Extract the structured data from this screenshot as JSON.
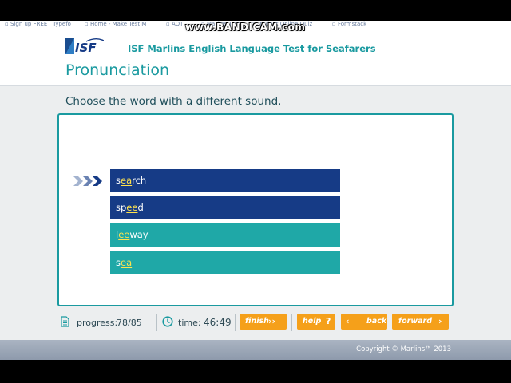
{
  "bookmarks": [
    "Sign up FREE | Typefo",
    "Home - Make Test M",
    "AQT",
    "Marlins Test",
    "Student Online Quiz",
    "Formstack"
  ],
  "watermark": "www.BANDICAM.com",
  "header": {
    "logo_text": "ISF",
    "app_title": "ISF Marlins English Language Test for Seafarers",
    "page_title": "Pronunciation"
  },
  "question": {
    "prompt": "Choose the word with a different sound.",
    "options": [
      {
        "pre": "s",
        "hl": "ea",
        "post": "rch",
        "style": "navy"
      },
      {
        "pre": "sp",
        "hl": "ee",
        "post": "d",
        "style": "navy"
      },
      {
        "pre": "l",
        "hl": "ee",
        "post": "way",
        "style": "teal"
      },
      {
        "pre": "s",
        "hl": "ea",
        "post": "",
        "style": "teal"
      }
    ]
  },
  "toolbar": {
    "progress_label": "progress:",
    "progress_value": "78/85",
    "time_label": "time:",
    "time_value": "46:49",
    "finish_label": "finish",
    "help_label": "help",
    "back_label": "back",
    "forward_label": "forward"
  },
  "footer": {
    "copyright": "Copyright © Marlins™ 2013"
  },
  "colors": {
    "teal": "#1a9aa0",
    "navy": "#163b86",
    "option_teal": "#1fa8a7",
    "button_orange": "#f5a01a",
    "highlight": "#ffe34d"
  },
  "icons": [
    "isf-logo",
    "triple-chevron-pointer-icon",
    "document-icon",
    "clock-icon",
    "double-chevron-right-icon",
    "question-mark-icon",
    "chevron-left-icon",
    "chevron-right-icon"
  ]
}
